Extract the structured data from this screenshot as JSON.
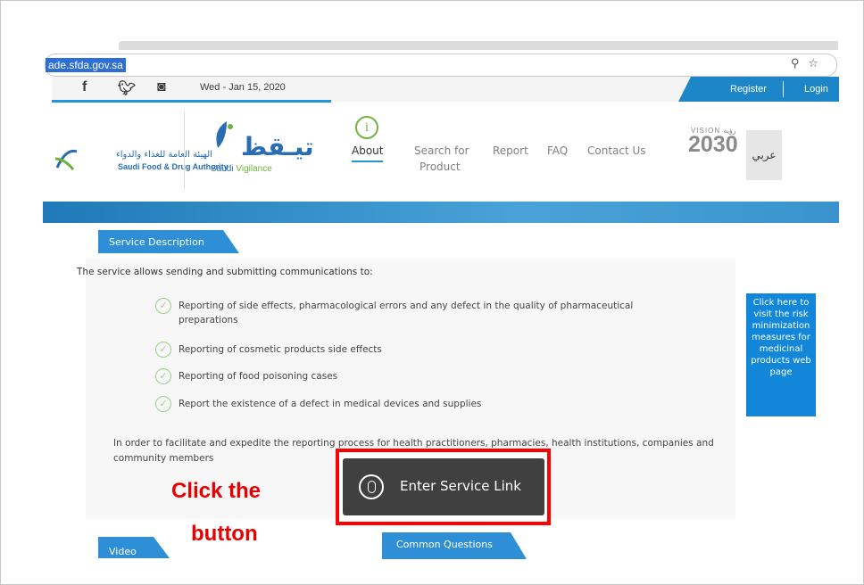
{
  "browser": {
    "url": "ade.sfda.gov.sa",
    "icons": [
      "zoom-icon",
      "star-icon"
    ]
  },
  "topbar": {
    "social": [
      "facebook",
      "twitter",
      "instagram"
    ],
    "date": "Wed - Jan 15, 2020",
    "register": "Register",
    "login": "Login"
  },
  "header": {
    "sfda_name_ar": "الهيئة العامة للغذاء والدواء",
    "sfda_name_en": "Saudi Food & Drug Authority",
    "vigilance_ar": "تيـقظ",
    "vigilance_en_a": "Saudi",
    "vigilance_en_b": " Vigilance",
    "about_icon": "i",
    "nav": [
      {
        "label": "About"
      },
      {
        "label": "Search for"
      },
      {
        "label": "Product"
      },
      {
        "label": "Report"
      },
      {
        "label": "FAQ"
      },
      {
        "label": "Contact Us"
      }
    ],
    "vision_small": "VISION رؤية",
    "vision_year": "2030",
    "language": "عربي"
  },
  "content": {
    "service_tab": "Service Description",
    "intro": "The service allows sending and submitting communications to:",
    "items": [
      "Reporting of side effects, pharmacological errors and any defect in the quality of pharmaceutical preparations",
      "Reporting of cosmetic products side effects",
      "Reporting of food poisoning cases",
      "Report the existence of a defect in medical devices and supplies"
    ],
    "paragraph": "In order to facilitate and expedite the reporting process for health practitioners, pharmacies, health institutions, companies and community members",
    "risk_box": "Click here to visit the risk minimization measures for medicinal products web page",
    "service_button": "Enter Service Link",
    "video_tab": "Video",
    "faq_tab": "Common Questions"
  },
  "annotation": {
    "line1": "Click the",
    "line2": "button",
    "color": "#e80000"
  },
  "colors": {
    "brand_blue": "#1f96d8",
    "tab_blue": "#2f8fd6",
    "button_dark": "#404040",
    "highlight_red": "#ff0000"
  }
}
